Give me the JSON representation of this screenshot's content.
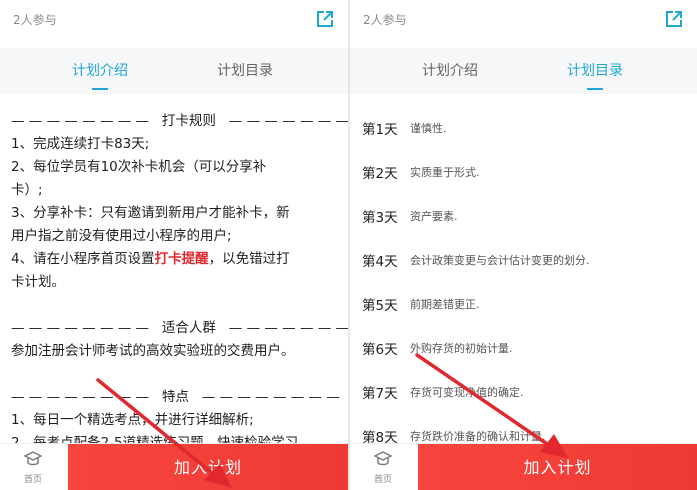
{
  "left_screen": {
    "participants": "2人参与",
    "tabs": [
      {
        "label": "计划介绍",
        "active": true
      },
      {
        "label": "计划目录",
        "active": false
      }
    ],
    "intro": {
      "rules_heading": "— — — — — — — —   打卡规则   — — — — — — — —",
      "rules_1": "1、完成连续打卡83天;",
      "rules_2a": "2、每位学员有10次补卡机会（可以分享补",
      "rules_2b": "卡）;",
      "rules_3a": "3、分享补卡：只有邀请到新用户才能补卡，新",
      "rules_3b": "用户指之前没有使用过小程序的用户;",
      "rules_4_pre": "4、请在小程序首页设置",
      "rules_4_hl": "打卡提醒",
      "rules_4_post": "，以免错过打",
      "rules_4b": "卡计划。",
      "audience_heading": "— — — — — — — —   适合人群   — — — — — — — —",
      "audience_text": "参加注册会计师考试的高效实验班的交费用户。",
      "features_heading": "— — — — — — — —   特点   — — — — — — — —",
      "features_1": "1、每日一个精选考点，并进行详细解析;",
      "features_2": "2、每考点配备2-5道精选练习题，快速检验学习"
    },
    "bottom": {
      "home_label": "首页",
      "join_label": "加入计划"
    }
  },
  "right_screen": {
    "participants": "2人参与",
    "tabs": [
      {
        "label": "计划介绍",
        "active": false
      },
      {
        "label": "计划目录",
        "active": true
      }
    ],
    "catalog": [
      {
        "day": "第1天",
        "title": "谨慎性."
      },
      {
        "day": "第2天",
        "title": "实质重于形式."
      },
      {
        "day": "第3天",
        "title": "资产要素."
      },
      {
        "day": "第4天",
        "title": "会计政策变更与会计估计变更的划分."
      },
      {
        "day": "第5天",
        "title": "前期差错更正."
      },
      {
        "day": "第6天",
        "title": "外购存货的初始计量."
      },
      {
        "day": "第7天",
        "title": "存货可变现净值的确定."
      },
      {
        "day": "第8天",
        "title": "存货跌价准备的确认和计量."
      }
    ],
    "bottom": {
      "home_label": "首页",
      "join_label": "加入计划"
    }
  },
  "colors": {
    "accent": "#20a8d4",
    "join_button": "#f0413a",
    "highlight": "#e0282e",
    "arrow": "#e0282e"
  }
}
